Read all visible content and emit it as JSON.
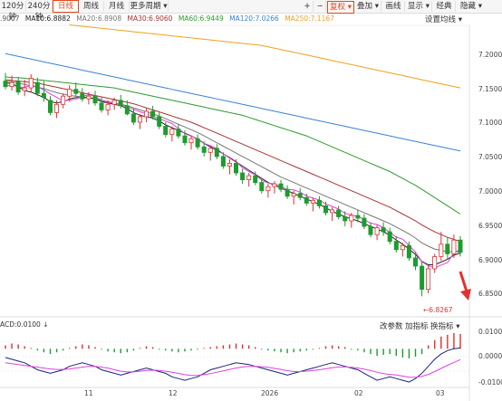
{
  "toolbar": {
    "items": [
      {
        "label": "120分钟"
      },
      {
        "label": "240分钟"
      },
      {
        "label": "日线"
      },
      {
        "label": "周线"
      },
      {
        "label": "月线"
      },
      {
        "label": "更多周期 ▾"
      },
      {
        "label": "+"
      },
      {
        "label": "−"
      },
      {
        "label": "复权 ▾"
      },
      {
        "label": "叠加 ▾"
      },
      {
        "label": "画线"
      },
      {
        "label": "显示 ▾"
      },
      {
        "label": "经典"
      },
      {
        "label": "隐藏 ▾"
      }
    ],
    "active_index": 2,
    "accent_color": "#e0491d"
  },
  "ma_legend": {
    "first": ".9007",
    "items": [
      {
        "label": "MA10:6.8882",
        "color": "#222222"
      },
      {
        "label": "MA20:6.8908",
        "color": "#777777"
      },
      {
        "label": "MA30:6.9060",
        "color": "#a83232"
      },
      {
        "label": "MA60:6.9449",
        "color": "#2f9a2f"
      },
      {
        "label": "MA120:7.0266",
        "color": "#3b82d6"
      },
      {
        "label": "MA250:7.1167",
        "color": "#f0a020"
      }
    ]
  },
  "settings_label": "设置均线 ▾",
  "price_axis": [
    "7.2000",
    "7.1500",
    "7.1000",
    "7.0500",
    "7.0000",
    "6.9500",
    "6.9000",
    "6.8500"
  ],
  "low_marker": "←6.8267",
  "indicator": {
    "label": "ACD:0.0100 ↓",
    "buttons": [
      "改参数",
      "加指标",
      "换指标 ▾"
    ],
    "axis": [
      "0.0100",
      "0.0000",
      "-0.0100"
    ]
  },
  "date_axis": [
    "11",
    "12",
    "2026",
    "02",
    "03"
  ],
  "colors": {
    "up": "#1e9b2e",
    "down": "#e03030",
    "ma10": "#222222",
    "ma20": "#777777",
    "ma30": "#a83232",
    "ma60": "#2f9a2f",
    "ma120": "#3b82d6",
    "ma250": "#f0a020",
    "pink": "#e040e0"
  },
  "chart_data": {
    "type": "candlestick",
    "y_range": [
      6.8,
      7.22
    ],
    "ohlc": [
      [
        7.14,
        7.152,
        7.128,
        7.132
      ],
      [
        7.132,
        7.148,
        7.126,
        7.138
      ],
      [
        7.14,
        7.146,
        7.12,
        7.124
      ],
      [
        7.126,
        7.142,
        7.118,
        7.13
      ],
      [
        7.13,
        7.15,
        7.124,
        7.144
      ],
      [
        7.138,
        7.145,
        7.118,
        7.122
      ],
      [
        7.122,
        7.14,
        7.11,
        7.116
      ],
      [
        7.112,
        7.118,
        7.09,
        7.094
      ],
      [
        7.094,
        7.112,
        7.086,
        7.106
      ],
      [
        7.106,
        7.122,
        7.1,
        7.118
      ],
      [
        7.118,
        7.134,
        7.11,
        7.128
      ],
      [
        7.128,
        7.138,
        7.118,
        7.122
      ],
      [
        7.122,
        7.13,
        7.11,
        7.114
      ],
      [
        7.114,
        7.124,
        7.106,
        7.118
      ],
      [
        7.118,
        7.126,
        7.104,
        7.108
      ],
      [
        7.108,
        7.116,
        7.094,
        7.098
      ],
      [
        7.098,
        7.112,
        7.09,
        7.106
      ],
      [
        7.106,
        7.116,
        7.098,
        7.112
      ],
      [
        7.112,
        7.12,
        7.1,
        7.104
      ],
      [
        7.104,
        7.112,
        7.09,
        7.092
      ],
      [
        7.092,
        7.1,
        7.076,
        7.08
      ],
      [
        7.08,
        7.092,
        7.07,
        7.088
      ],
      [
        7.088,
        7.1,
        7.08,
        7.096
      ],
      [
        7.096,
        7.104,
        7.084,
        7.088
      ],
      [
        7.088,
        7.094,
        7.07,
        7.074
      ],
      [
        7.074,
        7.08,
        7.058,
        7.062
      ],
      [
        7.062,
        7.074,
        7.052,
        7.07
      ],
      [
        7.07,
        7.078,
        7.056,
        7.06
      ],
      [
        7.06,
        7.068,
        7.046,
        7.05
      ],
      [
        7.05,
        7.06,
        7.04,
        7.056
      ],
      [
        7.056,
        7.062,
        7.04,
        7.044
      ],
      [
        7.044,
        7.052,
        7.03,
        7.036
      ],
      [
        7.036,
        7.046,
        7.024,
        7.042
      ],
      [
        7.042,
        7.048,
        7.026,
        7.03
      ],
      [
        7.03,
        7.036,
        7.012,
        7.016
      ],
      [
        7.016,
        7.026,
        7.004,
        7.02
      ],
      [
        7.02,
        7.026,
        7.002,
        7.006
      ],
      [
        7.006,
        7.012,
        6.99,
        6.996
      ],
      [
        6.996,
        7.006,
        6.986,
        7.002
      ],
      [
        7.002,
        7.008,
        6.988,
        6.992
      ],
      [
        6.992,
        6.998,
        6.976,
        6.98
      ],
      [
        6.98,
        6.99,
        6.97,
        6.986
      ],
      [
        6.986,
        6.994,
        6.976,
        6.99
      ],
      [
        6.99,
        6.996,
        6.978,
        6.982
      ],
      [
        6.982,
        6.988,
        6.968,
        6.972
      ],
      [
        6.972,
        6.98,
        6.96,
        6.976
      ],
      [
        6.976,
        6.984,
        6.966,
        6.97
      ],
      [
        6.97,
        6.976,
        6.958,
        6.962
      ],
      [
        6.962,
        6.97,
        6.95,
        6.966
      ],
      [
        6.966,
        6.972,
        6.954,
        6.958
      ],
      [
        6.958,
        6.964,
        6.944,
        6.948
      ],
      [
        6.948,
        6.956,
        6.936,
        6.952
      ],
      [
        6.952,
        6.958,
        6.938,
        6.942
      ],
      [
        6.942,
        6.95,
        6.928,
        6.936
      ],
      [
        6.936,
        6.948,
        6.926,
        6.944
      ],
      [
        6.944,
        6.952,
        6.934,
        6.94
      ],
      [
        6.94,
        6.946,
        6.924,
        6.928
      ],
      [
        6.928,
        6.934,
        6.912,
        6.916
      ],
      [
        6.916,
        6.93,
        6.908,
        6.926
      ],
      [
        6.926,
        6.934,
        6.914,
        6.92
      ],
      [
        6.92,
        6.926,
        6.902,
        6.906
      ],
      [
        6.906,
        6.914,
        6.89,
        6.894
      ],
      [
        6.894,
        6.904,
        6.884,
        6.9
      ],
      [
        6.9,
        6.906,
        6.878,
        6.882
      ],
      [
        6.882,
        6.89,
        6.864,
        6.87
      ],
      [
        6.87,
        6.878,
        6.826,
        6.836
      ],
      [
        6.836,
        6.872,
        6.83,
        6.866
      ],
      [
        6.866,
        6.888,
        6.86,
        6.884
      ],
      [
        6.884,
        6.92,
        6.878,
        6.902
      ],
      [
        6.902,
        6.912,
        6.88,
        6.888
      ],
      [
        6.888,
        6.916,
        6.882,
        6.908
      ],
      [
        6.908,
        6.914,
        6.884,
        6.89
      ]
    ],
    "ma_lines": {
      "ma10": [
        7.138,
        7.136,
        7.132,
        7.126,
        7.124,
        7.12,
        7.116,
        7.11,
        7.108,
        7.11,
        7.114,
        7.116,
        7.116,
        7.116,
        7.114,
        7.11,
        7.108,
        7.106,
        7.104,
        7.1,
        7.094,
        7.09,
        7.088,
        7.086,
        7.082,
        7.076,
        7.072,
        7.068,
        7.064,
        7.06,
        7.055,
        7.049,
        7.044,
        7.039,
        7.034,
        7.028,
        7.022,
        7.016,
        7.01,
        7.004,
        6.998,
        6.992,
        6.988,
        6.984,
        6.98,
        6.976,
        6.972,
        6.968,
        6.964,
        6.96,
        6.955,
        6.95,
        6.946,
        6.942,
        6.939,
        6.936,
        6.932,
        6.928,
        6.924,
        6.92,
        6.915,
        6.908,
        6.902,
        6.895,
        6.887,
        6.877,
        6.872,
        6.872,
        6.876,
        6.88,
        6.886,
        6.889
      ],
      "ma20": [
        7.14,
        7.139,
        7.137,
        7.135,
        7.133,
        7.131,
        7.129,
        7.126,
        7.123,
        7.121,
        7.119,
        7.118,
        7.117,
        7.116,
        7.114,
        7.112,
        7.11,
        7.108,
        7.106,
        7.104,
        7.101,
        7.098,
        7.095,
        7.092,
        7.089,
        7.085,
        7.081,
        7.077,
        7.073,
        7.069,
        7.065,
        7.06,
        7.055,
        7.05,
        7.045,
        7.04,
        7.035,
        7.03,
        7.025,
        7.02,
        7.015,
        7.01,
        7.005,
        7.0,
        6.996,
        6.992,
        6.988,
        6.984,
        6.98,
        6.976,
        6.972,
        6.968,
        6.964,
        6.96,
        6.956,
        6.952,
        6.948,
        6.944,
        6.94,
        6.936,
        6.932,
        6.927,
        6.922,
        6.917,
        6.911,
        6.904,
        6.899,
        6.895,
        6.893,
        6.891,
        6.891,
        6.891
      ],
      "ma30": [
        7.142,
        7.141,
        7.14,
        7.139,
        7.138,
        7.137,
        7.135,
        7.133,
        7.131,
        7.129,
        7.127,
        7.125,
        7.123,
        7.121,
        7.119,
        7.117,
        7.115,
        7.113,
        7.111,
        7.109,
        7.107,
        7.104,
        7.101,
        7.098,
        7.095,
        7.092,
        7.089,
        7.086,
        7.083,
        7.08,
        7.076,
        7.072,
        7.068,
        7.064,
        7.06,
        7.056,
        7.052,
        7.048,
        7.044,
        7.04,
        7.036,
        7.032,
        7.028,
        7.024,
        7.02,
        7.016,
        7.012,
        7.008,
        7.004,
        7.0,
        6.996,
        6.992,
        6.988,
        6.984,
        6.98,
        6.976,
        6.972,
        6.968,
        6.964,
        6.96,
        6.956,
        6.951,
        6.946,
        6.941,
        6.936,
        6.93,
        6.925,
        6.92,
        6.916,
        6.912,
        6.909,
        6.906
      ],
      "ma60": [
        7.146,
        7.145,
        7.145,
        7.144,
        7.143,
        7.142,
        7.141,
        7.14,
        7.139,
        7.138,
        7.137,
        7.136,
        7.135,
        7.134,
        7.133,
        7.132,
        7.131,
        7.13,
        7.128,
        7.126,
        7.124,
        7.122,
        7.12,
        7.118,
        7.116,
        7.114,
        7.112,
        7.11,
        7.108,
        7.106,
        7.104,
        7.102,
        7.1,
        7.098,
        7.096,
        7.094,
        7.092,
        7.09,
        7.087,
        7.084,
        7.081,
        7.078,
        7.075,
        7.072,
        7.069,
        7.066,
        7.063,
        7.06,
        7.056,
        7.052,
        7.048,
        7.044,
        7.04,
        7.036,
        7.032,
        7.028,
        7.024,
        7.02,
        7.016,
        7.012,
        7.008,
        7.003,
        6.998,
        6.993,
        6.988,
        6.982,
        6.976,
        6.97,
        6.964,
        6.958,
        6.952,
        6.946
      ],
      "ma120": [
        7.18,
        7.178,
        7.176,
        7.174,
        7.172,
        7.17,
        7.168,
        7.166,
        7.164,
        7.162,
        7.16,
        7.158,
        7.156,
        7.154,
        7.152,
        7.15,
        7.148,
        7.146,
        7.144,
        7.142,
        7.14,
        7.138,
        7.136,
        7.134,
        7.132,
        7.13,
        7.128,
        7.126,
        7.124,
        7.122,
        7.12,
        7.118,
        7.116,
        7.114,
        7.112,
        7.11,
        7.108,
        7.106,
        7.104,
        7.102,
        7.1,
        7.098,
        7.096,
        7.094,
        7.092,
        7.09,
        7.088,
        7.086,
        7.084,
        7.082,
        7.08,
        7.078,
        7.076,
        7.074,
        7.072,
        7.07,
        7.068,
        7.066,
        7.064,
        7.062,
        7.06,
        7.058,
        7.056,
        7.054,
        7.052,
        7.05,
        7.048,
        7.046,
        7.044,
        7.042,
        7.04,
        7.038
      ]
    },
    "ma250": {
      "start_index": 10,
      "values": [
        7.222,
        7.221,
        7.22,
        7.219,
        7.218,
        7.217,
        7.216,
        7.215,
        7.214,
        7.213,
        7.212,
        7.211,
        7.21,
        7.209,
        7.208,
        7.207,
        7.206,
        7.205,
        7.204,
        7.203,
        7.202,
        7.201,
        7.2,
        7.199,
        7.198,
        7.197,
        7.196,
        7.195,
        7.194,
        7.193,
        7.192,
        7.19,
        7.188,
        7.186,
        7.184,
        7.182,
        7.18,
        7.178,
        7.176,
        7.174,
        7.172,
        7.17,
        7.168,
        7.166,
        7.164,
        7.162,
        7.16,
        7.158,
        7.156,
        7.154,
        7.152,
        7.15,
        7.148,
        7.146,
        7.144,
        7.142,
        7.14,
        7.138,
        7.136,
        7.134,
        7.132,
        7.13
      ]
    },
    "macd_hist": [
      0.002,
      0.003,
      0.0025,
      0.0015,
      0.0005,
      -0.001,
      -0.002,
      -0.003,
      -0.002,
      -0.001,
      0.0005,
      0.0015,
      0.0025,
      0.002,
      0.001,
      -0.0005,
      -0.0015,
      -0.002,
      -0.0025,
      -0.002,
      -0.001,
      0.0005,
      0.0015,
      0.001,
      -0.0005,
      -0.001,
      -0.0015,
      -0.002,
      -0.0015,
      -0.001,
      -0.0005,
      0.0005,
      0.001,
      0.0015,
      0.002,
      0.0025,
      0.003,
      0.0025,
      0.002,
      0.001,
      -0.0005,
      -0.001,
      -0.0015,
      -0.002,
      -0.0025,
      -0.002,
      -0.0015,
      -0.001,
      -0.0005,
      0.0005,
      0.0015,
      0.002,
      0.0015,
      0.001,
      -0.0005,
      -0.001,
      -0.002,
      -0.003,
      -0.004,
      -0.0035,
      -0.003,
      -0.004,
      -0.005,
      -0.0055,
      -0.0045,
      -0.003,
      0.002,
      0.005,
      0.007,
      0.008,
      0.009,
      0.0085
    ],
    "macd_dif": [
      -0.005,
      -0.006,
      -0.007,
      -0.008,
      -0.01,
      -0.012,
      -0.013,
      -0.014,
      -0.013,
      -0.012,
      -0.01,
      -0.009,
      -0.008,
      -0.009,
      -0.01,
      -0.012,
      -0.013,
      -0.014,
      -0.015,
      -0.014,
      -0.013,
      -0.012,
      -0.011,
      -0.012,
      -0.013,
      -0.014,
      -0.016,
      -0.017,
      -0.018,
      -0.017,
      -0.016,
      -0.014,
      -0.012,
      -0.011,
      -0.01,
      -0.009,
      -0.008,
      -0.0085,
      -0.009,
      -0.01,
      -0.011,
      -0.012,
      -0.013,
      -0.014,
      -0.015,
      -0.014,
      -0.013,
      -0.012,
      -0.011,
      -0.01,
      -0.009,
      -0.008,
      -0.009,
      -0.01,
      -0.011,
      -0.012,
      -0.014,
      -0.016,
      -0.018,
      -0.017,
      -0.016,
      -0.017,
      -0.018,
      -0.019,
      -0.017,
      -0.014,
      -0.01,
      -0.006,
      -0.003,
      -0.001,
      0.0,
      0.0005
    ],
    "macd_dea": [
      -0.008,
      -0.0085,
      -0.009,
      -0.0095,
      -0.01,
      -0.0105,
      -0.011,
      -0.0115,
      -0.0118,
      -0.0118,
      -0.0115,
      -0.011,
      -0.0105,
      -0.01,
      -0.01,
      -0.0105,
      -0.011,
      -0.012,
      -0.0128,
      -0.0132,
      -0.0132,
      -0.0128,
      -0.0124,
      -0.0122,
      -0.0124,
      -0.0128,
      -0.0134,
      -0.014,
      -0.0148,
      -0.0152,
      -0.0152,
      -0.0148,
      -0.0142,
      -0.0134,
      -0.0126,
      -0.0118,
      -0.011,
      -0.0104,
      -0.01,
      -0.01,
      -0.0102,
      -0.0106,
      -0.0112,
      -0.0118,
      -0.0125,
      -0.013,
      -0.013,
      -0.0128,
      -0.0124,
      -0.012,
      -0.0114,
      -0.0108,
      -0.0104,
      -0.0104,
      -0.0106,
      -0.011,
      -0.0116,
      -0.0124,
      -0.0134,
      -0.0142,
      -0.0146,
      -0.015,
      -0.0156,
      -0.0162,
      -0.0163,
      -0.0158,
      -0.0146,
      -0.013,
      -0.0112,
      -0.0094,
      -0.0078,
      -0.0062
    ],
    "macd_range": [
      -0.02,
      0.01
    ]
  }
}
